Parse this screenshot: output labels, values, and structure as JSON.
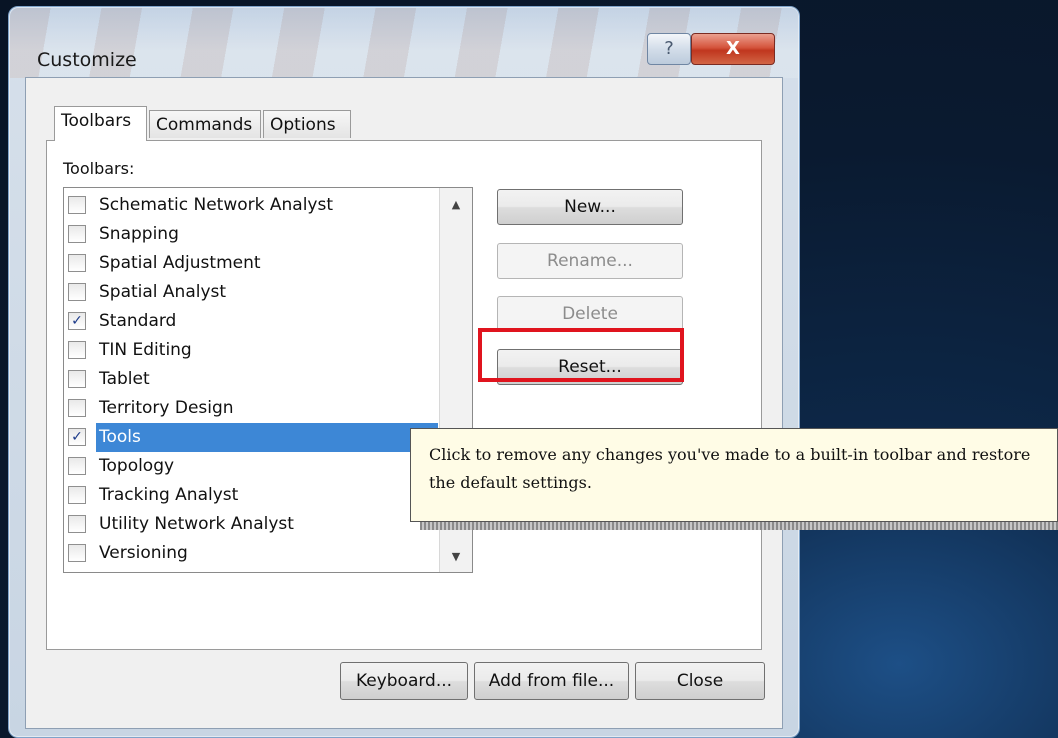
{
  "window": {
    "title": "Customize",
    "help_label": "?",
    "close_label": "X"
  },
  "tabs": [
    {
      "label": "Toolbars",
      "active": true
    },
    {
      "label": "Commands",
      "active": false
    },
    {
      "label": "Options",
      "active": false
    }
  ],
  "panel": {
    "label": "Toolbars:"
  },
  "toolbars_list": [
    {
      "label": "Schematic Network Analyst",
      "checked": false
    },
    {
      "label": "Snapping",
      "checked": false
    },
    {
      "label": "Spatial Adjustment",
      "checked": false
    },
    {
      "label": "Spatial Analyst",
      "checked": false
    },
    {
      "label": "Standard",
      "checked": true
    },
    {
      "label": "TIN Editing",
      "checked": false
    },
    {
      "label": "Tablet",
      "checked": false
    },
    {
      "label": "Territory Design",
      "checked": false
    },
    {
      "label": "Tools",
      "checked": true,
      "selected": true
    },
    {
      "label": "Topology",
      "checked": false
    },
    {
      "label": "Tracking Analyst",
      "checked": false
    },
    {
      "label": "Utility Network Analyst",
      "checked": false
    },
    {
      "label": "Versioning",
      "checked": false
    }
  ],
  "buttons": {
    "new": "New...",
    "rename": "Rename...",
    "delete": "Delete",
    "reset": "Reset..."
  },
  "bottom_buttons": {
    "keyboard": "Keyboard...",
    "add_from_file": "Add from file...",
    "close": "Close"
  },
  "tooltip": {
    "text": "Click to remove any changes you've made to a built-in toolbar and restore the default settings."
  },
  "colors": {
    "highlight": "#e0141e",
    "selection": "#3d87d6",
    "tooltip_bg": "#fffce6"
  }
}
